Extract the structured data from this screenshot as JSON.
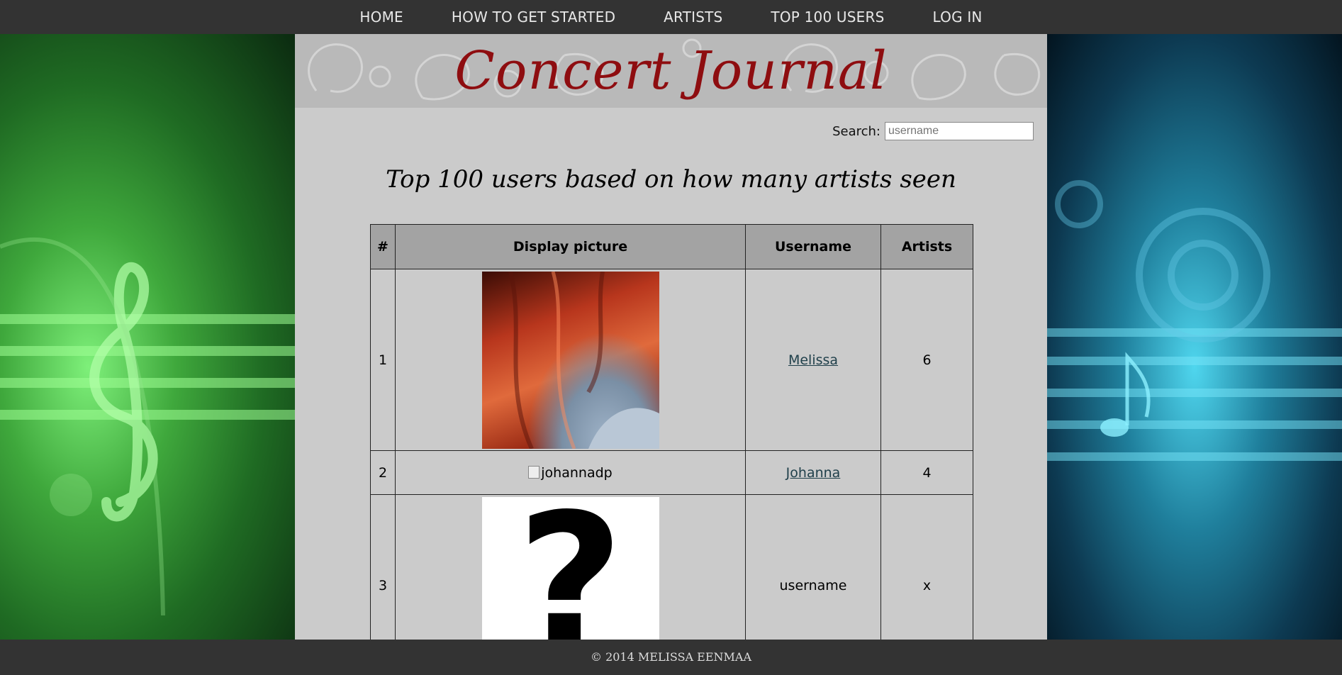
{
  "nav": {
    "items": [
      {
        "label": "HOME"
      },
      {
        "label": "HOW TO GET STARTED"
      },
      {
        "label": "ARTISTS"
      },
      {
        "label": "TOP 100 USERS"
      },
      {
        "label": "LOG IN"
      }
    ]
  },
  "banner": {
    "logo_text": "Concert Journal"
  },
  "search": {
    "label": "Search:",
    "placeholder": "username",
    "value": ""
  },
  "page": {
    "heading": "Top 100 users based on how many artists seen"
  },
  "table": {
    "headers": [
      "#",
      "Display picture",
      "Username",
      "Artists"
    ],
    "rows": [
      {
        "rank": "1",
        "picture": "photo",
        "picture_alt": "",
        "username": "Melissa",
        "artists": "6"
      },
      {
        "rank": "2",
        "picture": "broken",
        "picture_alt": "johannadp",
        "username": "Johanna",
        "artists": "4"
      },
      {
        "rank": "3",
        "picture": "question-mark",
        "picture_alt": "",
        "username": "username",
        "artists": "x"
      }
    ]
  },
  "footer": {
    "text": "© 2014 MELISSA EENMAA"
  },
  "colors": {
    "nav_bg": "#333333",
    "logo": "#8e0d10",
    "link": "#1f3f4a",
    "panel": "#cbcbcb"
  }
}
